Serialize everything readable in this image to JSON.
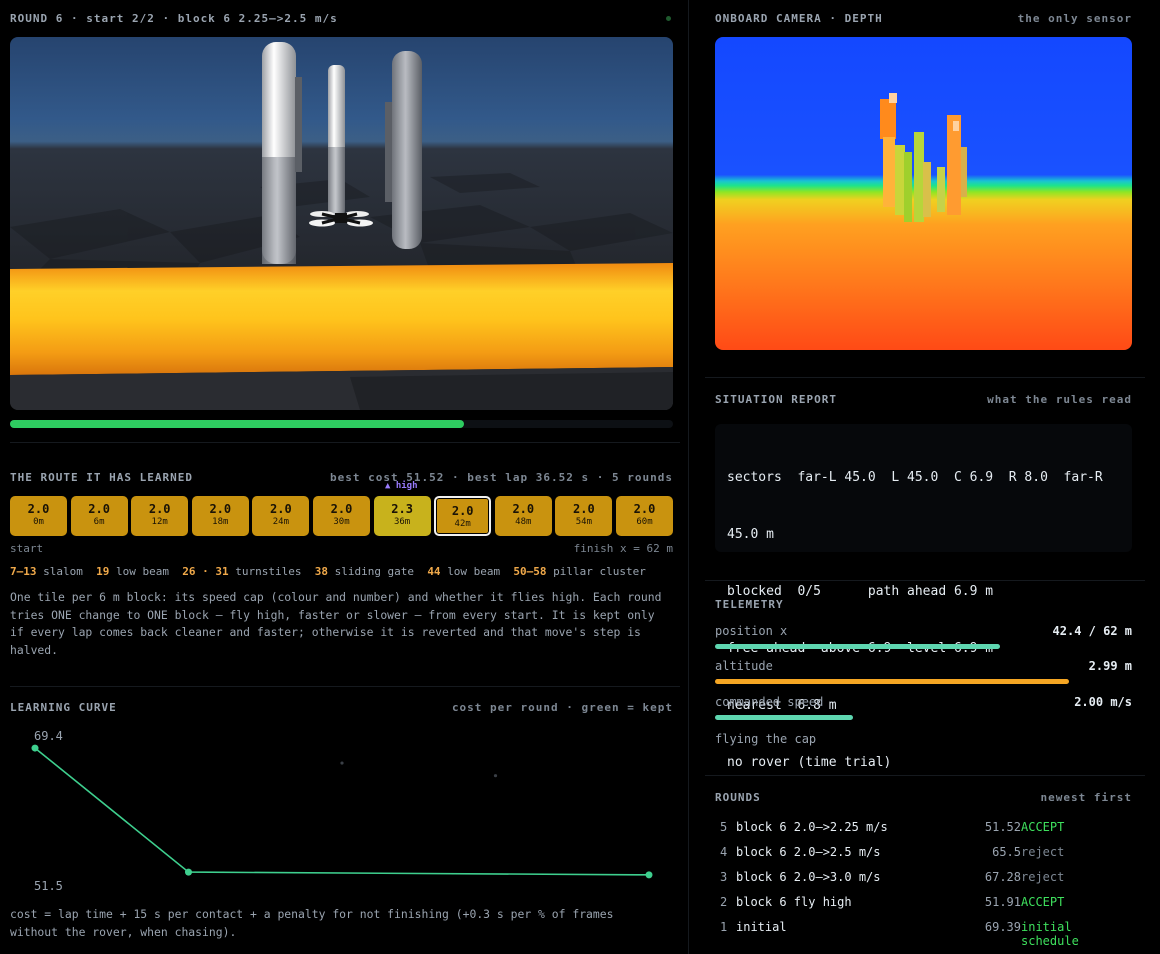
{
  "sim": {
    "title": "ROUND 6 · start 2/2 · block 6 2.25–>2.5 m/s",
    "progress_fraction": 0.685
  },
  "camera": {
    "title": "ONBOARD CAMERA · DEPTH",
    "subtitle": "the only sensor"
  },
  "route": {
    "title": "THE ROUTE IT HAS LEARNED",
    "stats": "best cost 51.52 · best lap 36.52 s · 5 rounds",
    "high_tag": "▲ high",
    "tiles": [
      {
        "value": "2.0",
        "dist": "0m"
      },
      {
        "value": "2.0",
        "dist": "6m"
      },
      {
        "value": "2.0",
        "dist": "12m"
      },
      {
        "value": "2.0",
        "dist": "18m"
      },
      {
        "value": "2.0",
        "dist": "24m"
      },
      {
        "value": "2.0",
        "dist": "30m"
      },
      {
        "value": "2.3",
        "dist": "36m"
      },
      {
        "value": "2.0",
        "dist": "42m"
      },
      {
        "value": "2.0",
        "dist": "48m"
      },
      {
        "value": "2.0",
        "dist": "54m"
      },
      {
        "value": "2.0",
        "dist": "60m"
      }
    ],
    "start_label": "start",
    "finish_label": "finish x = 62 m",
    "obstacles": [
      {
        "range": "7–13",
        "name": "slalom"
      },
      {
        "range": "19",
        "name": "low beam"
      },
      {
        "range": "26 · 31",
        "name": "turnstiles"
      },
      {
        "range": "38",
        "name": "sliding gate"
      },
      {
        "range": "44",
        "name": "low beam"
      },
      {
        "range": "50–58",
        "name": "pillar cluster"
      }
    ],
    "description_lines": [
      "One tile per 6 m block: its speed cap (colour and number) and whether it flies high. Each round",
      "tries ONE change to ONE block — fly high, faster or slower — from every start. It is kept only",
      "if every lap comes back cleaner and faster; otherwise it is reverted and that move's step is",
      "halved."
    ]
  },
  "curve": {
    "title": "LEARNING CURVE",
    "subtitle": "cost per round · green = kept",
    "max_label": "69.4",
    "min_label": "51.5",
    "footer_lines": [
      "cost = lap time + 15 s per contact + a penalty for not finishing (+0.3 s per % of frames",
      "without the rover, when chasing)."
    ]
  },
  "chart_data": {
    "type": "line",
    "title": "LEARNING CURVE",
    "x": [
      1,
      2,
      3,
      4,
      5
    ],
    "series": [
      {
        "values": [
          69.39,
          51.91,
          67.28,
          65.5,
          51.52
        ],
        "kept": [
          true,
          true,
          false,
          false,
          true
        ]
      }
    ],
    "ylim": [
      51.5,
      69.4
    ]
  },
  "situation": {
    "title": "SITUATION REPORT",
    "subtitle": "what the rules read",
    "lines": [
      "sectors  far-L 45.0  L 45.0  C 6.9  R 8.0  far-R",
      "45.0 m",
      "blocked  0/5      path ahead 6.9 m",
      "free ahead  above 6.9  level 6.9 m",
      "nearest  6.8 m",
      "no rover (time trial)"
    ]
  },
  "telemetry": {
    "title": "TELEMETRY",
    "position_label": "position x",
    "position_value": "42.4 / 62 m",
    "position_fraction": 0.684,
    "altitude_label": "altitude",
    "altitude_value": "2.99 m",
    "altitude_fraction": 0.85,
    "speed_label": "commanded speed",
    "speed_value": "2.00 m/s",
    "speed_fraction": 0.33,
    "status": "flying the cap",
    "colors": {
      "position": "#5ed6b0",
      "altitude": "#f5a623",
      "speed": "#5ed6b0"
    }
  },
  "rounds": {
    "title": "ROUNDS",
    "subtitle": "newest first",
    "rows": [
      {
        "n": "5",
        "desc": "block 6 2.0–>2.25 m/s",
        "cost": "51.52",
        "result": "ACCEPT",
        "kind": "acc"
      },
      {
        "n": "4",
        "desc": "block 6 2.0–>2.5 m/s",
        "cost": "65.5",
        "result": "reject",
        "kind": "rej"
      },
      {
        "n": "3",
        "desc": "block 6 2.0–>3.0 m/s",
        "cost": "67.28",
        "result": "reject",
        "kind": "rej"
      },
      {
        "n": "2",
        "desc": "block 6 fly high",
        "cost": "51.91",
        "result": "ACCEPT",
        "kind": "acc"
      },
      {
        "n": "1",
        "desc": "initial",
        "cost": "69.39",
        "result": "initial schedule",
        "kind": "init"
      }
    ]
  }
}
